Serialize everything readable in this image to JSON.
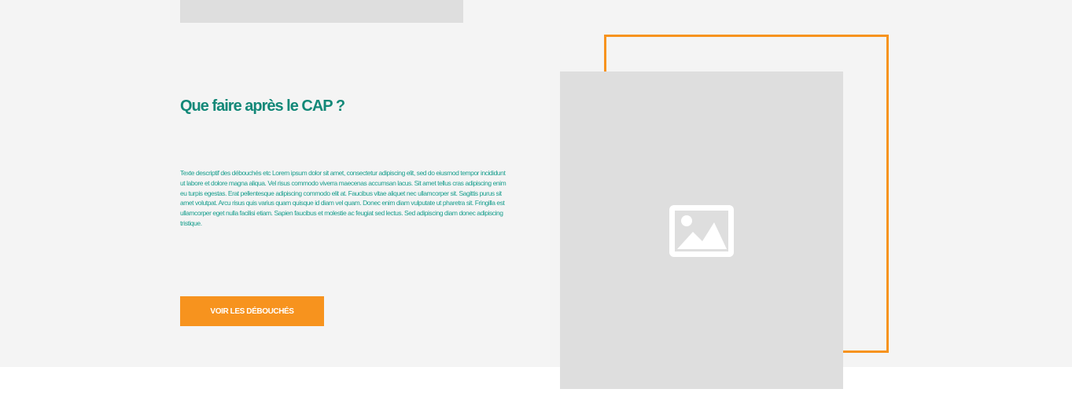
{
  "section": {
    "title": "Que faire après le CAP ?",
    "description": "Texte descriptif des débouchés etc Lorem ipsum dolor sit amet, consectetur adipiscing elit, sed do eiusmod tempor incididunt ut labore et dolore magna aliqua. Vel risus commodo viverra maecenas accumsan lacus. Sit amet tellus cras adipiscing enim eu turpis egestas. Erat pellentesque adipiscing commodo elit at. Faucibus vitae aliquet nec ullamcorper sit. Sagittis purus sit amet volutpat. Arcu risus quis varius quam quisque id diam vel quam. Donec enim diam vulputate ut pharetra sit. Fringilla est ullamcorper eget nulla facilisi etiam. Sapien faucibus et molestie ac feugiat sed lectus. Sed adipiscing diam donec adipiscing tristique.",
    "button_label": "VOIR LES DÉBOUCHÉS"
  },
  "icons": {
    "image_placeholder": "image-icon"
  },
  "colors": {
    "accent_teal": "#138878",
    "accent_orange": "#f7931e",
    "section_background": "#f4f4f4",
    "placeholder_gray": "#dedede"
  }
}
